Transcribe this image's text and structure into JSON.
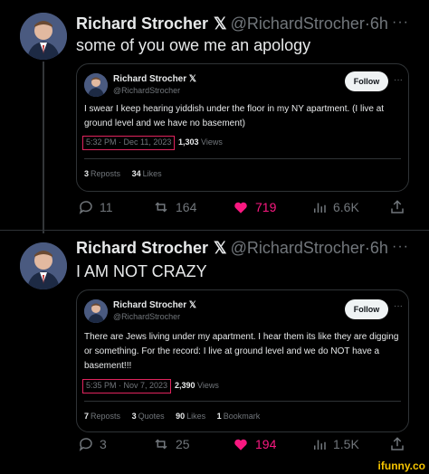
{
  "posts": [
    {
      "author_name": "Richard Strocher",
      "verified_mark": "𝕏",
      "handle": "@RichardStrocher",
      "dot": "·",
      "time": "6h",
      "more": "···",
      "text": "some of you owe me an apology",
      "quote": {
        "author_name": "Richard Strocher",
        "verified_mark": "𝕏",
        "handle": "@RichardStrocher",
        "follow_label": "Follow",
        "more": "···",
        "body": "I swear I keep hearing yiddish under the floor in my NY apartment. (I live at ground level and we have no basement)",
        "timestamp": "5:32 PM · Dec 11, 2023",
        "views_count": "1,303",
        "views_label": "Views",
        "stats": [
          {
            "count": "3",
            "label": "Reposts"
          },
          {
            "count": "34",
            "label": "Likes"
          }
        ]
      },
      "actions": {
        "replies": "11",
        "reposts": "164",
        "likes": "719",
        "views": "6.6K"
      }
    },
    {
      "author_name": "Richard Strocher",
      "verified_mark": "𝕏",
      "handle": "@RichardStrocher",
      "dot": "·",
      "time": "6h",
      "more": "···",
      "text": "I AM NOT CRAZY",
      "quote": {
        "author_name": "Richard Strocher",
        "verified_mark": "𝕏",
        "handle": "@RichardStrocher",
        "follow_label": "Follow",
        "more": "···",
        "body": "There are Jews living under my apartment. I hear them its like they are digging or something. For the record: I live at ground level and we do NOT have a basement!!!",
        "timestamp": "5:35 PM · Nov 7, 2023",
        "views_count": "2,390",
        "views_label": "Views",
        "stats": [
          {
            "count": "7",
            "label": "Reposts"
          },
          {
            "count": "3",
            "label": "Quotes"
          },
          {
            "count": "90",
            "label": "Likes"
          },
          {
            "count": "1",
            "label": "Bookmark"
          }
        ]
      },
      "actions": {
        "replies": "3",
        "reposts": "25",
        "likes": "194",
        "views": "1.5K"
      }
    }
  ],
  "watermark": "ifunny.co",
  "colors": {
    "background": "#000000",
    "text": "#e7e9ea",
    "muted": "#71767b",
    "like": "#f91880",
    "highlight_box": "#e0245e",
    "watermark": "#f5c400"
  },
  "icons": [
    "reply-icon",
    "repost-icon",
    "heart-icon",
    "views-icon",
    "share-icon"
  ]
}
